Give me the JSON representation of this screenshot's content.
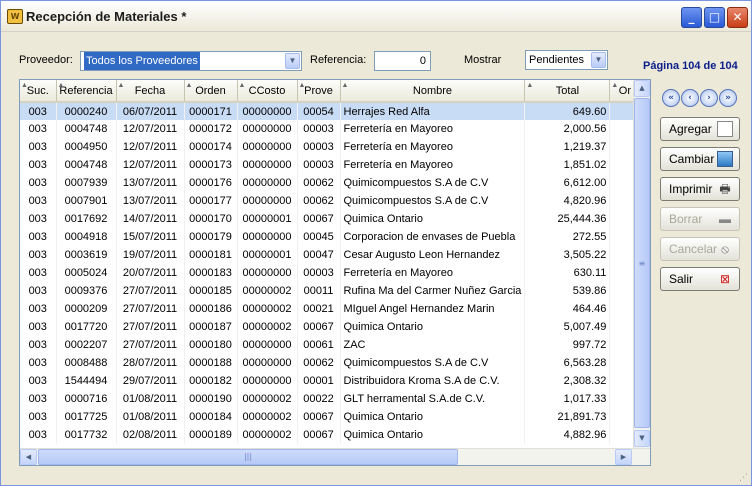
{
  "window": {
    "title": "Recepción de Materiales *",
    "app_icon": "folder-icon"
  },
  "filters": {
    "proveedor_label": "Proveedor:",
    "proveedor_value": "Todos los Proveedores",
    "referencia_label": "Referencia:",
    "referencia_value": "0",
    "mostrar_label": "Mostrar",
    "mostrar_value": "Pendientes"
  },
  "pagination": {
    "indicator": "Página 104 de 104"
  },
  "table": {
    "columns": [
      "Suc.",
      "Referencia",
      "Fecha",
      "Orden",
      "CCosto",
      "Prove",
      "Nombre",
      "Total",
      "Or"
    ],
    "rows": [
      [
        "003",
        "0000240",
        "06/07/2011",
        "0000171",
        "00000000",
        "00054",
        "Herrajes Red Alfa",
        "649.60"
      ],
      [
        "003",
        "0004748",
        "12/07/2011",
        "0000172",
        "00000000",
        "00003",
        "Ferretería en Mayoreo",
        "2,000.56"
      ],
      [
        "003",
        "0004950",
        "12/07/2011",
        "0000174",
        "00000000",
        "00003",
        "Ferretería en Mayoreo",
        "1,219.37"
      ],
      [
        "003",
        "0004748",
        "12/07/2011",
        "0000173",
        "00000000",
        "00003",
        "Ferretería en Mayoreo",
        "1,851.02"
      ],
      [
        "003",
        "0007939",
        "13/07/2011",
        "0000176",
        "00000000",
        "00062",
        "Quimicompuestos S.A de C.V",
        "6,612.00"
      ],
      [
        "003",
        "0007901",
        "13/07/2011",
        "0000177",
        "00000000",
        "00062",
        "Quimicompuestos S.A de C.V",
        "4,820.96"
      ],
      [
        "003",
        "0017692",
        "14/07/2011",
        "0000170",
        "00000001",
        "00067",
        "Quimica Ontario",
        "25,444.36"
      ],
      [
        "003",
        "0004918",
        "15/07/2011",
        "0000179",
        "00000000",
        "00045",
        "Corporacion de envases de Puebla",
        "272.55"
      ],
      [
        "003",
        "0003619",
        "19/07/2011",
        "0000181",
        "00000001",
        "00047",
        "Cesar Augusto Leon Hernandez",
        "3,505.22"
      ],
      [
        "003",
        "0005024",
        "20/07/2011",
        "0000183",
        "00000000",
        "00003",
        "Ferretería en Mayoreo",
        "630.11"
      ],
      [
        "003",
        "0009376",
        "27/07/2011",
        "0000185",
        "00000002",
        "00011",
        "Rufina Ma del Carmer Nuñez Garcia",
        "539.86"
      ],
      [
        "003",
        "0000209",
        "27/07/2011",
        "0000186",
        "00000002",
        "00021",
        "MIguel Angel Hernandez Marin",
        "464.46"
      ],
      [
        "003",
        "0017720",
        "27/07/2011",
        "0000187",
        "00000002",
        "00067",
        "Quimica Ontario",
        "5,007.49"
      ],
      [
        "003",
        "0002207",
        "27/07/2011",
        "0000180",
        "00000000",
        "00061",
        "ZAC",
        "997.72"
      ],
      [
        "003",
        "0008488",
        "28/07/2011",
        "0000188",
        "00000000",
        "00062",
        "Quimicompuestos S.A de C.V",
        "6,563.28"
      ],
      [
        "003",
        "1544494",
        "29/07/2011",
        "0000182",
        "00000000",
        "00001",
        "Distribuidora Kroma S.A de C.V.",
        "2,308.32"
      ],
      [
        "003",
        "0000716",
        "01/08/2011",
        "0000190",
        "00000002",
        "00022",
        "GLT herramental S.A.de C.V.",
        "1,017.33"
      ],
      [
        "003",
        "0017725",
        "01/08/2011",
        "0000184",
        "00000002",
        "00067",
        "Quimica Ontario",
        "21,891.73"
      ],
      [
        "003",
        "0017732",
        "02/08/2011",
        "0000189",
        "00000002",
        "00067",
        "Quimica Ontario",
        "4,882.96"
      ]
    ],
    "selected_row": 0
  },
  "actions": {
    "agregar": "Agregar",
    "cambiar": "Cambiar",
    "imprimir": "Imprimir",
    "borrar": "Borrar",
    "cancelar": "Cancelar",
    "salir": "Salir"
  },
  "icons": {
    "first": "first-page-icon",
    "prev": "previous-page-icon",
    "next": "next-page-icon",
    "last": "last-page-icon"
  },
  "colors": {
    "selected_row": "#c9dcf5",
    "page_indicator": "#0a1d8a",
    "close_button": "#c83d17"
  }
}
